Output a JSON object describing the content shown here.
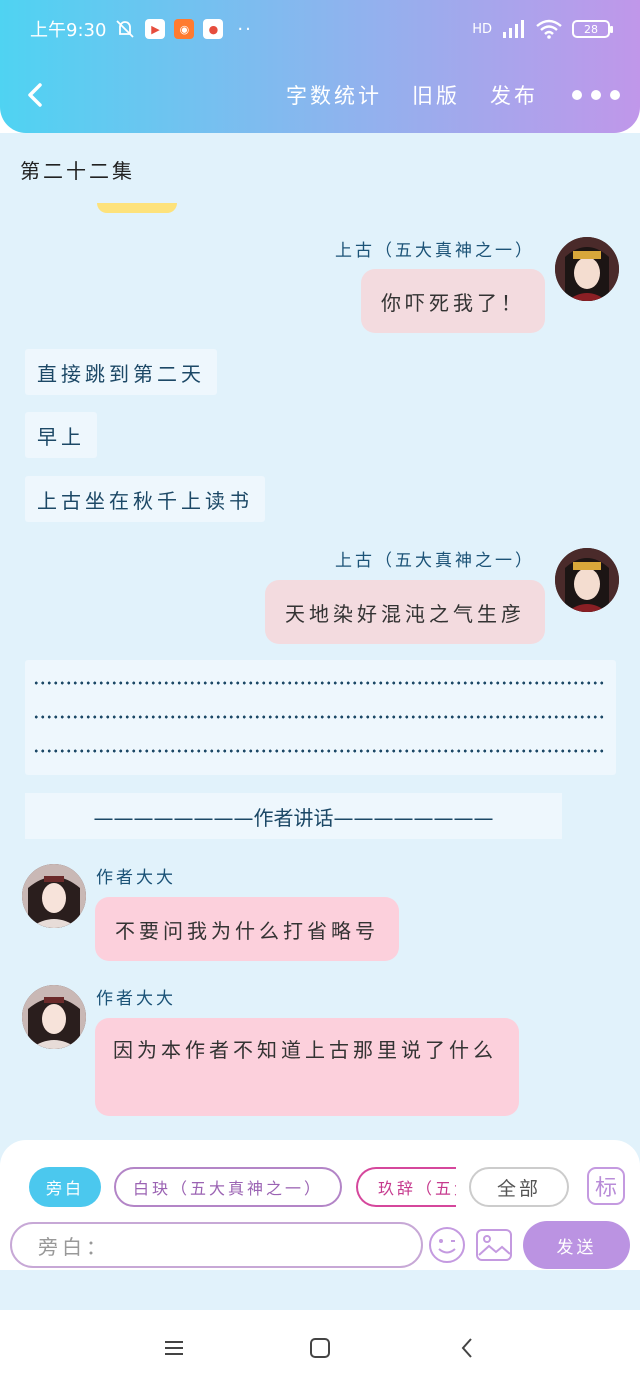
{
  "status_bar": {
    "time": "上午9:30",
    "battery": "28",
    "network": "HD"
  },
  "nav": {
    "word_count": "字数统计",
    "old_version": "旧版",
    "publish": "发布"
  },
  "episode_title": "第二十二集",
  "messages": [
    {
      "type": "right",
      "name": "上古（五大真神之一）",
      "text": "你吓死我了！"
    },
    {
      "type": "narration",
      "text": "直接跳到第二天"
    },
    {
      "type": "narration",
      "text": "早上"
    },
    {
      "type": "narration",
      "text": "上古坐在秋千上读书"
    },
    {
      "type": "right",
      "name": "上古（五大真神之一）",
      "text": "天地染好混沌之气生彦"
    },
    {
      "type": "ellipsis_block"
    },
    {
      "type": "divider",
      "text": "————————作者讲话————————"
    },
    {
      "type": "left",
      "name": "作者大大",
      "text": "不要问我为什么打省略号"
    },
    {
      "type": "left",
      "name": "作者大大",
      "text": "因为本作者不知道上古那里说了什么"
    }
  ],
  "role_chips": {
    "narration": "旁白",
    "role1": "白玦（五大真神之一）",
    "role2": "玖辞（五大真神之一）",
    "all": "全部",
    "mark": "标"
  },
  "input": {
    "placeholder": "旁白："
  },
  "send_label": "发送",
  "colors": {
    "header_start": "#4fd3f2",
    "header_end": "#c097ea",
    "chat_bg": "#e1f2fb",
    "author_bubble": "#fcd0dc",
    "send_button": "#bb93e2"
  }
}
